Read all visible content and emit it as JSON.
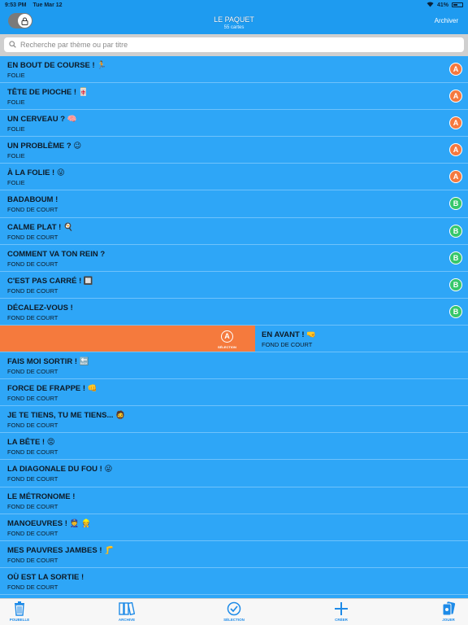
{
  "status": {
    "time": "9:53 PM",
    "date": "Tue Mar 12",
    "battery": "41%"
  },
  "nav": {
    "title": "LE PAQUET",
    "subtitle": "55 cartes",
    "archive_label": "Archiver"
  },
  "search": {
    "placeholder": "Recherche par thème ou par titre"
  },
  "colors": {
    "bar": "#1E9BF0",
    "row_bg": "#2EA6F7",
    "badge_a": "#F5793F",
    "badge_b": "#36C76A",
    "swipe": "#F57A3D"
  },
  "rows": [
    {
      "title": "EN BOUT DE COURSE ! 🏃",
      "sub": "FOLIE",
      "badge": "A"
    },
    {
      "title": "TÊTE DE PIOCHE ! 🀄",
      "sub": "FOLIE",
      "badge": "A"
    },
    {
      "title": "UN CERVEAU ? 🧠",
      "sub": "FOLIE",
      "badge": "A"
    },
    {
      "title": "UN PROBLÈME ? 😉",
      "sub": "FOLIE",
      "badge": "A"
    },
    {
      "title": "À LA FOLIE ! 😜",
      "sub": "FOLIE",
      "badge": "A"
    },
    {
      "title": "BADABOUM !",
      "sub": "FOND DE COURT",
      "badge": "B"
    },
    {
      "title": "CALME PLAT ! 🍳",
      "sub": "FOND DE COURT",
      "badge": "B"
    },
    {
      "title": "COMMENT VA TON REIN ?",
      "sub": "FOND DE COURT",
      "badge": "B"
    },
    {
      "title": "C'EST PAS CARRÉ ! 🔲",
      "sub": "FOND DE COURT",
      "badge": "B"
    },
    {
      "title": "DÉCALEZ-VOUS !",
      "sub": "FOND DE COURT",
      "badge": "B"
    },
    {
      "title": "EN AVANT ! 🤜",
      "sub": "FOND DE COURT",
      "badge": "",
      "swipe_label": "SÉLECTION",
      "swipe_badge": "A"
    },
    {
      "title": "FAIS MOI SORTIR ! 🔙",
      "sub": "FOND DE COURT",
      "badge": ""
    },
    {
      "title": "FORCE DE FRAPPE ! 👊",
      "sub": "FOND DE COURT",
      "badge": ""
    },
    {
      "title": "JE TE TIENS, TU ME TIENS... 🧔",
      "sub": "FOND DE COURT",
      "badge": ""
    },
    {
      "title": "LA BÊTE ! 😡",
      "sub": "FOND DE COURT",
      "badge": ""
    },
    {
      "title": "LA DIAGONALE DU FOU ! 😜",
      "sub": "FOND DE COURT",
      "badge": ""
    },
    {
      "title": "LE MÉTRONOME !",
      "sub": "FOND DE COURT",
      "badge": ""
    },
    {
      "title": "MANOEUVRES ! 👮 👷",
      "sub": "FOND DE COURT",
      "badge": ""
    },
    {
      "title": "MES PAUVRES JAMBES ! 🦵",
      "sub": "FOND DE COURT",
      "badge": ""
    },
    {
      "title": "OÙ EST LA SORTIE !",
      "sub": "FOND DE COURT",
      "badge": ""
    }
  ],
  "tabs": [
    {
      "label": "POUBELLE",
      "icon": "trash-icon"
    },
    {
      "label": "ARCHIVE",
      "icon": "archive-icon"
    },
    {
      "label": "SÉLECTION",
      "icon": "check-circle-icon"
    },
    {
      "label": "CRÉER",
      "icon": "plus-icon"
    },
    {
      "label": "JOUER",
      "icon": "play-cards-icon"
    }
  ]
}
